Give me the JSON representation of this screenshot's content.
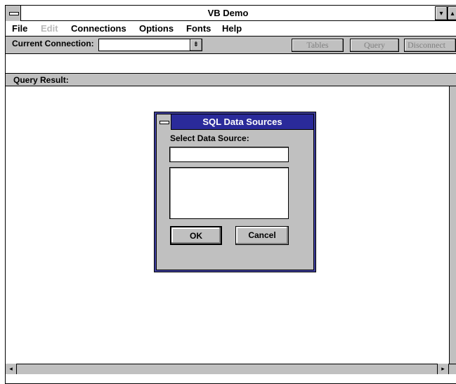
{
  "window": {
    "title": "VB Demo",
    "min_glyph": "▾",
    "max_glyph": "▴"
  },
  "menu": {
    "file": "File",
    "edit": "Edit",
    "connections": "Connections",
    "options": "Options",
    "fonts": "Fonts",
    "help": "Help"
  },
  "toolbar": {
    "current_connection_label": "Current Connection:",
    "current_connection_value": "",
    "dropdown_glyph": "⇟",
    "tables": "Tables",
    "query": "Query",
    "disconnect": "Disconnect"
  },
  "query_result": {
    "label": "Query Result:"
  },
  "scrollbar": {
    "left_glyph": "◂",
    "right_glyph": "▸"
  },
  "dialog": {
    "title": "SQL Data Sources",
    "select_label": "Select Data Source:",
    "input_value": "",
    "list_items": [],
    "ok": "OK",
    "cancel": "Cancel"
  },
  "colors": {
    "chrome": "#c0c0c0",
    "dialog_title": "#2a2a9a",
    "dialog_frame": "#4040a0",
    "disabled_text": "#808080"
  }
}
